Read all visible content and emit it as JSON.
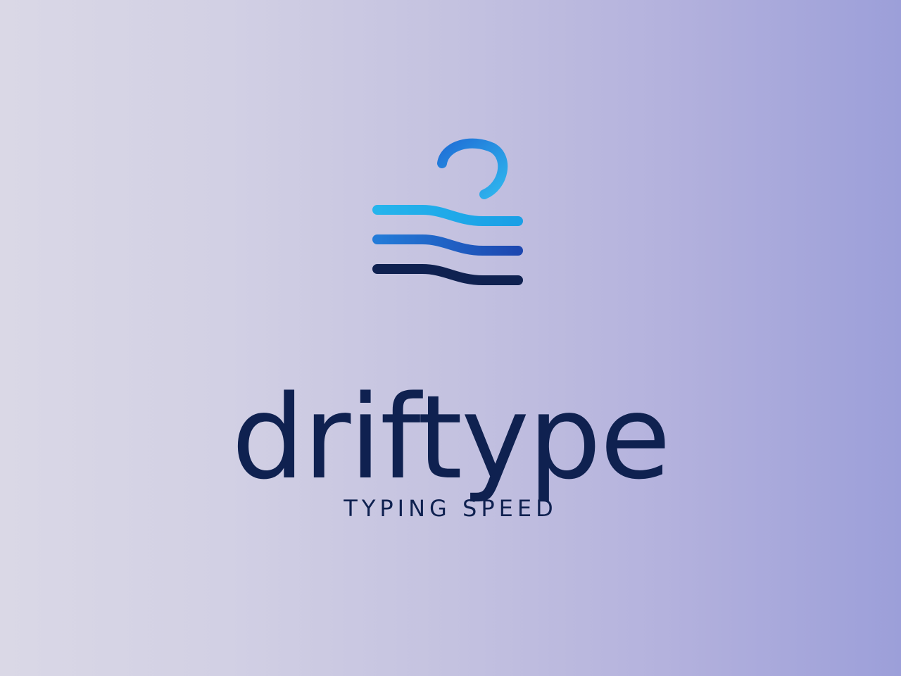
{
  "brand": {
    "name": "driftype",
    "tagline": "TYPING SPEED"
  },
  "icons": {
    "logo": "wave-lines-hook-icon"
  },
  "colors": {
    "ink": "#0f2150",
    "wave_top": "#24b0ea",
    "wave_middle": "#1f5ec8",
    "wave_bottom": "#0f2150",
    "hook": "#2a8fe8"
  }
}
